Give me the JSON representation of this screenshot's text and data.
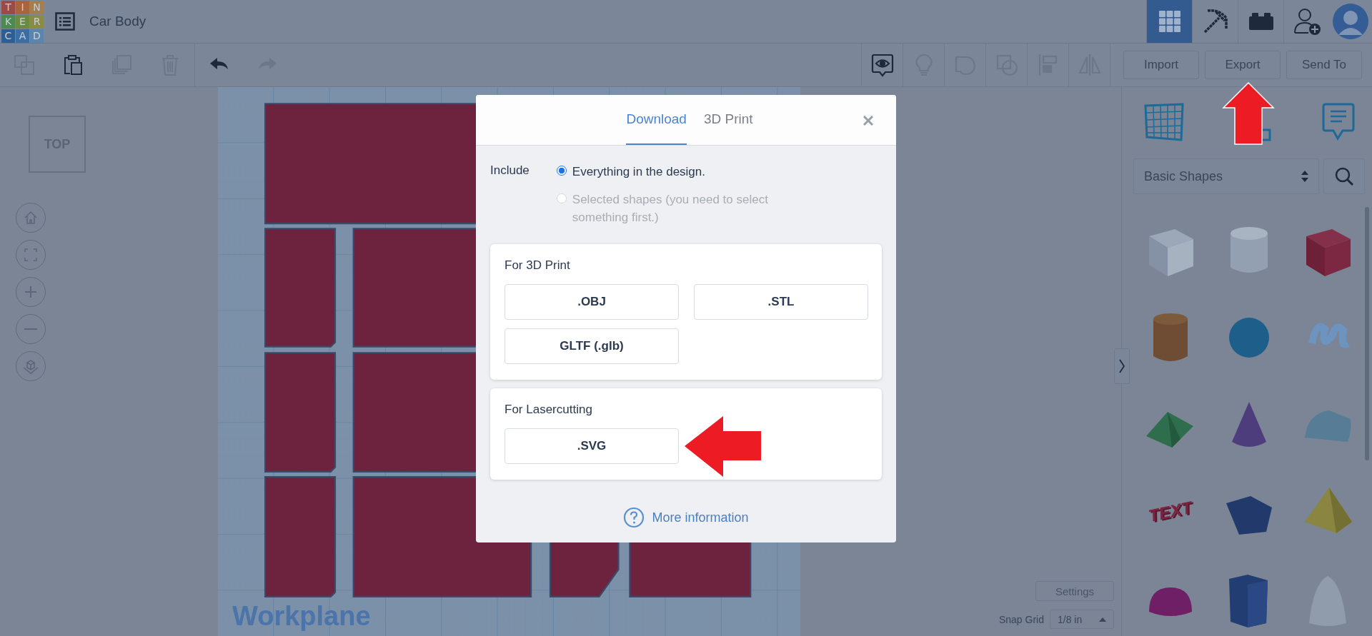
{
  "header": {
    "logo": [
      "T",
      "I",
      "N",
      "K",
      "E",
      "R",
      "C",
      "A",
      "D"
    ],
    "title": "Car Body",
    "view_buttons": [
      {
        "kind": "grid",
        "selected": true
      },
      {
        "kind": "pickaxe",
        "selected": false
      },
      {
        "kind": "brick",
        "selected": false
      }
    ]
  },
  "toolbar": {
    "edit_tools": [
      {
        "kind": "copy",
        "disabled": true
      },
      {
        "kind": "paste",
        "disabled": false
      },
      {
        "kind": "duplicate",
        "disabled": true
      },
      {
        "kind": "delete",
        "disabled": true
      },
      {
        "kind": "undo",
        "disabled": false
      },
      {
        "kind": "redo",
        "disabled": true
      }
    ],
    "shape_tools": [
      {
        "kind": "note",
        "disabled": false
      },
      {
        "kind": "bulb",
        "disabled": true
      },
      {
        "kind": "group",
        "disabled": true
      },
      {
        "kind": "ungroup",
        "disabled": true
      },
      {
        "kind": "align",
        "disabled": true
      },
      {
        "kind": "mirror",
        "disabled": true
      }
    ],
    "buttons": [
      "Import",
      "Export",
      "Send To"
    ]
  },
  "view_cube": {
    "label": "TOP"
  },
  "workplane": {
    "label": "Workplane"
  },
  "shape_panel": {
    "category": "Basic Shapes",
    "shapes": [
      {
        "kind": "striped-box"
      },
      {
        "kind": "striped-cylinder"
      },
      {
        "kind": "box"
      },
      {
        "kind": "cylinder"
      },
      {
        "kind": "sphere"
      },
      {
        "kind": "scribble"
      },
      {
        "kind": "roof"
      },
      {
        "kind": "cone"
      },
      {
        "kind": "round-roof"
      },
      {
        "kind": "text",
        "label": "TEXT"
      },
      {
        "kind": "polygon"
      },
      {
        "kind": "pyramid"
      },
      {
        "kind": "half-sphere"
      },
      {
        "kind": "prism"
      },
      {
        "kind": "paraboloid"
      }
    ]
  },
  "grid_settings": {
    "settings": "Settings",
    "label": "Snap Grid",
    "value": "1/8 in"
  },
  "dialog": {
    "tabs": [
      {
        "label": "Download",
        "selected": true
      },
      {
        "label": "3D Print",
        "selected": false
      }
    ],
    "include": {
      "label": "Include",
      "options": [
        {
          "label": "Everything in the design.",
          "selected": true,
          "disabled": false
        },
        {
          "label": "Selected shapes (you need to select something first.)",
          "selected": false,
          "disabled": true
        }
      ]
    },
    "sections": [
      {
        "title": "For 3D Print",
        "formats": [
          ".OBJ",
          ".STL",
          "GLTF (.glb)"
        ]
      },
      {
        "title": "For Lasercutting",
        "formats": [
          ".SVG"
        ]
      }
    ],
    "help": "More information"
  }
}
